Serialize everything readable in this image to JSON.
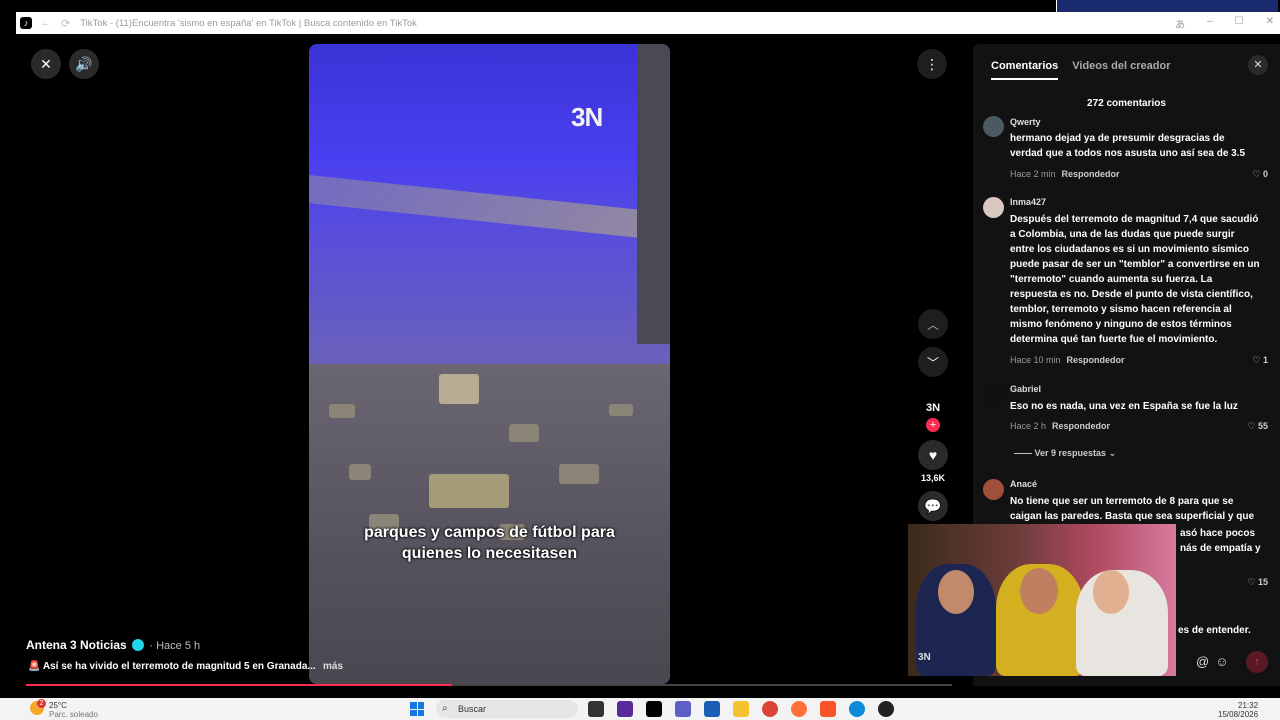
{
  "browser": {
    "title": "TikTok - (11)Encuentra 'sismo en españa' en TikTok | Busca contenido en TikTok",
    "back": "←",
    "reload": "⟳"
  },
  "video": {
    "watermark": "3N",
    "subtitle_line1": "parques y campos de fútbol para",
    "subtitle_line2": "quienes lo necesitasen",
    "more": "más",
    "progress": 0.46
  },
  "author": {
    "name": "Antena 3 Noticias",
    "time": "· Hace 5 h",
    "description": "🚨 Así se ha vivido el terremoto de magnitud 5 en Granada..."
  },
  "actions": {
    "channel_logo": "3N",
    "like_count": "13,6K"
  },
  "comments_panel": {
    "tabs": [
      "Comentarios",
      "Videos del creador"
    ],
    "count_label": "272 comentarios",
    "reply_label": "Respondedor",
    "view_replies": "Ver 9 respuestas",
    "comments": [
      {
        "user": "Qwerty",
        "text": "hermano dejad ya de presumir desgracias de verdad que a todos nos asusta uno así sea de 3.5",
        "time": "Hace 2 min",
        "likes": "0"
      },
      {
        "user": "Inma427",
        "text": "Después del terremoto de magnitud 7,4 que sacudió a Colombia, una de las dudas que puede surgir entre los ciudadanos es si un movimiento sísmico puede pasar de ser un \"temblor\" a convertirse en un \"terremoto\" cuando aumenta su fuerza. La respuesta es no. Desde el punto de vista científico, temblor, terremoto y sismo hacen referencia al mismo fenómeno y ninguno de estos términos determina qué tan fuerte fue el movimiento.",
        "time": "Hace 10 min",
        "likes": "1"
      },
      {
        "user": "Gabriel",
        "text": "Eso no es nada, una vez en España se fue la luz",
        "time": "Hace 2 h",
        "likes": "55"
      },
      {
        "user": "Anacé",
        "text": "No tiene que ser un terremoto de 8 para que se caigan las paredes. Basta que sea superficial y que los suelos",
        "frag1": "asó hace pocos",
        "frag2": "nás de empatía y",
        "likes": "15"
      }
    ],
    "trailing_fragment": "es de entender."
  },
  "webcam": {
    "watermark": "3N"
  },
  "taskbar": {
    "temperature": "25°C",
    "weather": "Parc. soleado",
    "badge": "2",
    "search_placeholder": "Buscar",
    "time": "21:32",
    "date": "15/08/2026"
  },
  "colors": {
    "accent": "#fe2c55",
    "panel_bg": "#121212",
    "verified": "#20d5ec"
  }
}
